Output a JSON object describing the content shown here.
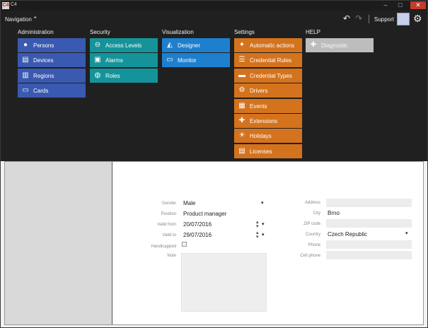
{
  "window": {
    "app_icon_text": "C4",
    "title": "C4",
    "minimize": "–",
    "maximize": "□",
    "close": "✕"
  },
  "topbar": {
    "nav_label": "Navigation",
    "undo_icon": "undo-icon",
    "redo_icon": "redo-icon",
    "support_label": "Support",
    "settings_icon": "gear-icon"
  },
  "menu": {
    "columns": [
      {
        "header": "Administration",
        "color": "#3a59b0",
        "items": [
          {
            "label": "Persons",
            "icon": "person-icon"
          },
          {
            "label": "Devices",
            "icon": "device-icon"
          },
          {
            "label": "Regions",
            "icon": "building-icon"
          },
          {
            "label": "Cards",
            "icon": "card-icon"
          }
        ]
      },
      {
        "header": "Security",
        "color": "#14949a",
        "items": [
          {
            "label": "Access Levels",
            "icon": "key-icon"
          },
          {
            "label": "Alarms",
            "icon": "alarm-icon"
          },
          {
            "label": "Roles",
            "icon": "roles-icon"
          }
        ]
      },
      {
        "header": "Visualization",
        "color": "#1e7fce",
        "items": [
          {
            "label": "Designer",
            "icon": "compass-icon"
          },
          {
            "label": "Monitor",
            "icon": "monitor-icon"
          }
        ]
      },
      {
        "header": "Settings",
        "color": "#d4731d",
        "items": [
          {
            "label": "Automatic actions",
            "icon": "wand-icon"
          },
          {
            "label": "Credential Rules",
            "icon": "rules-icon"
          },
          {
            "label": "Credential Types",
            "icon": "types-icon"
          },
          {
            "label": "Drivers",
            "icon": "driver-icon"
          },
          {
            "label": "Events",
            "icon": "events-icon"
          },
          {
            "label": "Extensions",
            "icon": "puzzle-icon"
          },
          {
            "label": "Holidays",
            "icon": "sun-icon"
          },
          {
            "label": "Licenses",
            "icon": "license-icon"
          }
        ]
      },
      {
        "header": "HELP",
        "color": "#bdbdbd",
        "items": [
          {
            "label": "Diagnostic",
            "icon": "diagnostic-icon"
          }
        ]
      }
    ]
  },
  "form": {
    "gender": {
      "label": "Gender",
      "value": "Male"
    },
    "position": {
      "label": "Position",
      "value": "Product manager"
    },
    "valid_from": {
      "label": "Valid from",
      "value": "20/07/2016"
    },
    "valid_to": {
      "label": "Valid to",
      "value": "29/07/2016"
    },
    "handicapped": {
      "label": "Handicapped",
      "checked": false
    },
    "note": {
      "label": "Note",
      "value": ""
    },
    "address": {
      "label": "Address",
      "value": ""
    },
    "city": {
      "label": "City",
      "value": "Brno"
    },
    "zip": {
      "label": "ZIP code",
      "value": ""
    },
    "country": {
      "label": "Country",
      "value": "Czech Republic"
    },
    "phone": {
      "label": "Phone",
      "value": ""
    },
    "cell_phone": {
      "label": "Cell phone",
      "value": ""
    }
  }
}
